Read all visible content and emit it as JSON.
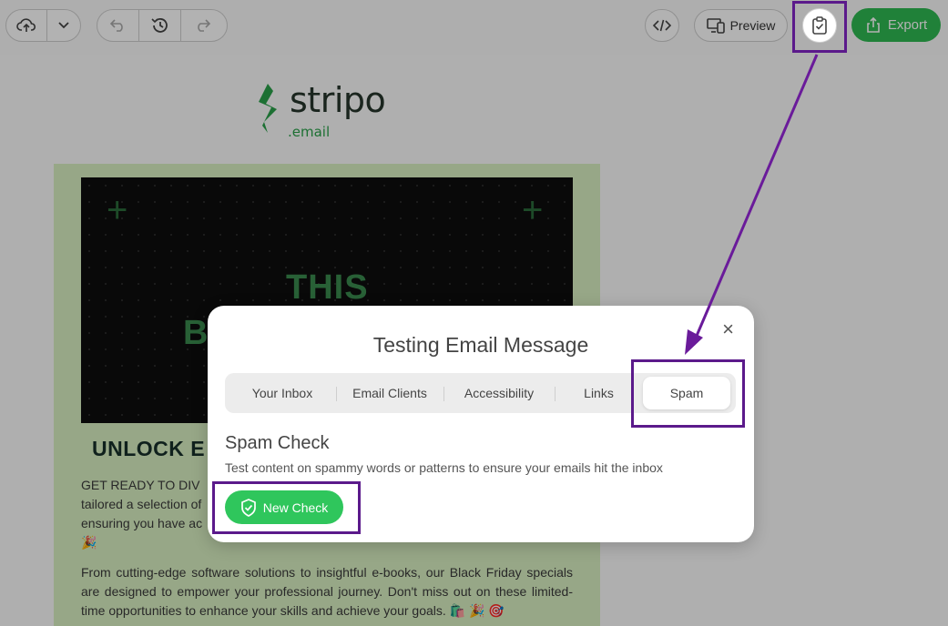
{
  "toolbar": {
    "preview_label": "Preview",
    "export_label": "Export"
  },
  "email": {
    "logo_main": "stripo",
    "logo_sub": ".email",
    "hero_line1": "THIS",
    "hero_line2": "B",
    "heading": "UNLOCK E",
    "para1_line1": "GET READY TO DIV",
    "para1_line2": "tailored a selection of",
    "para1_line3": "ensuring you have ac",
    "para1_line4": "🎉",
    "para2": "From cutting-edge software solutions to insightful e-books, our Black Friday specials are designed to empower your professional journey. Don't miss out on these limited-time opportunities to enhance your skills and achieve your goals. 🛍️ 🎉 🎯"
  },
  "modal": {
    "title": "Testing Email Message",
    "close": "×",
    "tabs": [
      {
        "label": "Your Inbox"
      },
      {
        "label": "Email Clients"
      },
      {
        "label": "Accessibility"
      },
      {
        "label": "Links"
      },
      {
        "label": "Spam"
      }
    ],
    "active_tab": "Spam",
    "section_title": "Spam Check",
    "section_desc": "Test content on spammy words or patterns to ensure your emails hit the inbox",
    "new_check_label": "New Check"
  },
  "colors": {
    "accent_green": "#2eb952",
    "annotation_purple": "#5b1a8b"
  }
}
